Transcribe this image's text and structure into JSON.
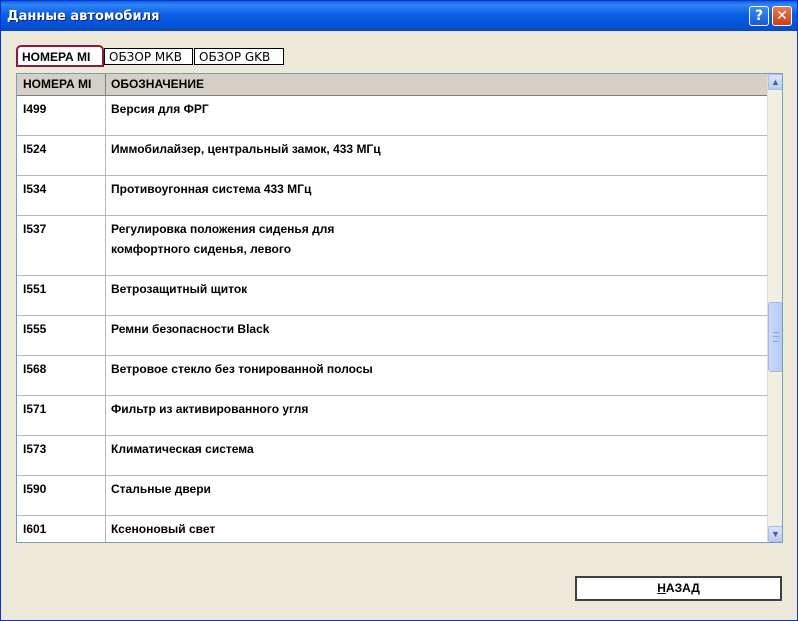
{
  "window": {
    "title": "Данные автомобиля",
    "help_icon": "?",
    "close_icon": "✕"
  },
  "tabs": [
    {
      "label": "НОМЕРА MI",
      "active": true
    },
    {
      "label": "ОБЗОР МКВ",
      "active": false
    },
    {
      "label": "ОБЗОР GKB",
      "active": false
    }
  ],
  "table": {
    "headers": {
      "code": "НОМЕРА MI",
      "description": "ОБОЗНАЧЕНИЕ"
    },
    "rows": [
      {
        "code": "I499",
        "desc_line1": "Версия для ФРГ",
        "desc_line2": ""
      },
      {
        "code": "I524",
        "desc_line1": "Иммобилайзер, центральный замок, 433 МГц",
        "desc_line2": ""
      },
      {
        "code": "I534",
        "desc_line1": "Противоугонная система 433 МГц",
        "desc_line2": ""
      },
      {
        "code": "I537",
        "desc_line1": "Регулировка положения сиденья для",
        "desc_line2": "комфортного сиденья, левого"
      },
      {
        "code": "I551",
        "desc_line1": "Ветрозащитный щиток",
        "desc_line2": ""
      },
      {
        "code": "I555",
        "desc_line1": "Ремни безопасности Black",
        "desc_line2": ""
      },
      {
        "code": "I568",
        "desc_line1": "Ветровое стекло без тонированной полосы",
        "desc_line2": ""
      },
      {
        "code": "I571",
        "desc_line1": "Фильтр из активированного угля",
        "desc_line2": ""
      },
      {
        "code": "I573",
        "desc_line1": "Климатическая система",
        "desc_line2": ""
      },
      {
        "code": "I590",
        "desc_line1": "Стальные двери",
        "desc_line2": ""
      },
      {
        "code": "I601",
        "desc_line1": "Ксеноновый свет",
        "desc_line2": ""
      }
    ]
  },
  "scrollbar": {
    "up_icon": "▲",
    "down_icon": "▼"
  },
  "footer": {
    "back_hotkey": "Н",
    "back_rest": "АЗАД"
  },
  "colors": {
    "titlebar": "#0551d6",
    "active_tab_border": "#8b1a38",
    "window_bg": "#ece9d8"
  }
}
